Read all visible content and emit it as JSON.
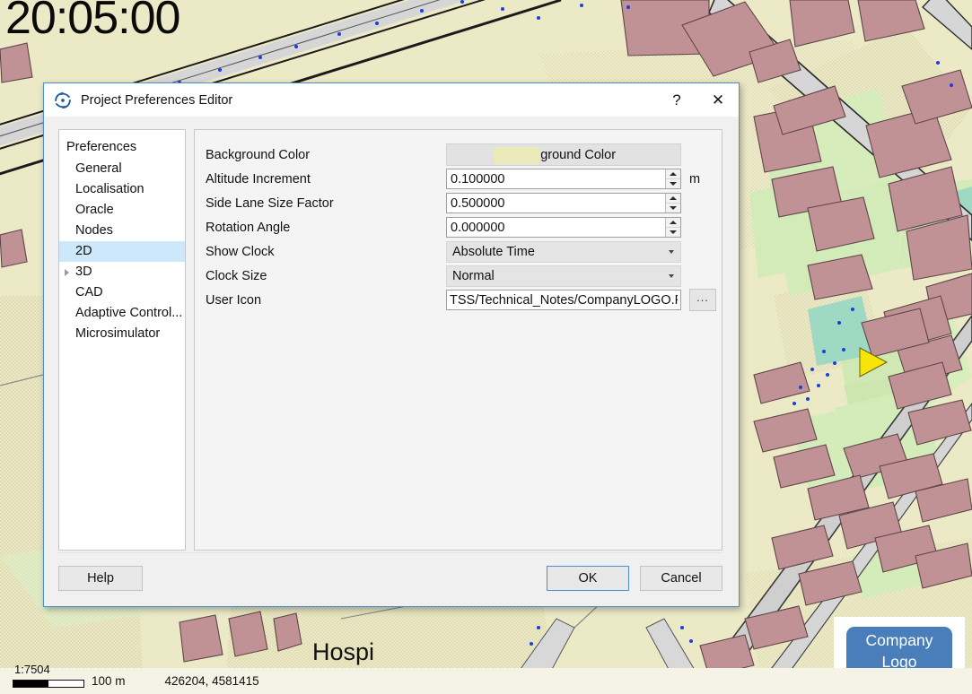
{
  "simulation": {
    "clock": "20:05:00",
    "district_label": "Hospi",
    "logo": {
      "line1": "Company",
      "line2": "Logo"
    }
  },
  "status_bar": {
    "scale_ratio": "1:7504",
    "scale_distance": "100 m",
    "coordinates": "426204, 4581415"
  },
  "dialog": {
    "title": "Project Preferences Editor",
    "icon": "aimsun-swirl-icon",
    "help_button": "?",
    "close_button": "✕",
    "tree": {
      "root_label": "Preferences",
      "items": [
        {
          "label": "General",
          "selected": false,
          "expandable": false
        },
        {
          "label": "Localisation",
          "selected": false,
          "expandable": false
        },
        {
          "label": "Oracle",
          "selected": false,
          "expandable": false
        },
        {
          "label": "Nodes",
          "selected": false,
          "expandable": false
        },
        {
          "label": "2D",
          "selected": true,
          "expandable": false
        },
        {
          "label": "3D",
          "selected": false,
          "expandable": true
        },
        {
          "label": "CAD",
          "selected": false,
          "expandable": false
        },
        {
          "label": "Adaptive Control...",
          "selected": false,
          "expandable": false
        },
        {
          "label": "Microsimulator",
          "selected": false,
          "expandable": false
        }
      ]
    },
    "fields": {
      "background_color": {
        "label": "Background Color",
        "button_label": "Background Color",
        "swatch_color": "#eae9b9"
      },
      "altitude_increment": {
        "label": "Altitude Increment",
        "value": "0.100000",
        "unit": "m"
      },
      "side_lane_size_factor": {
        "label": "Side Lane Size Factor",
        "value": "0.500000",
        "unit": ""
      },
      "rotation_angle": {
        "label": "Rotation Angle",
        "value": "0.000000",
        "unit": ""
      },
      "show_clock": {
        "label": "Show Clock",
        "value": "Absolute Time",
        "options": [
          "Absolute Time"
        ]
      },
      "clock_size": {
        "label": "Clock Size",
        "value": "Normal",
        "options": [
          "Normal"
        ]
      },
      "user_icon": {
        "label": "User Icon",
        "value": "TSS/Technical_Notes/CompanyLOGO.PNG",
        "browse_label": "..."
      }
    },
    "buttons": {
      "help": "Help",
      "ok": "OK",
      "cancel": "Cancel"
    }
  },
  "colors": {
    "map_background": "#ece9c6",
    "map_green": "#cfe8b4",
    "map_building": "#c09296",
    "map_road": "#d8d8d8",
    "map_teal": "#9fd9c4",
    "accent_blue": "#4a8fd0",
    "selection_blue": "#cde8fb",
    "logo_blue": "#4a7ebb",
    "marker_yellow": "#f7e509"
  }
}
